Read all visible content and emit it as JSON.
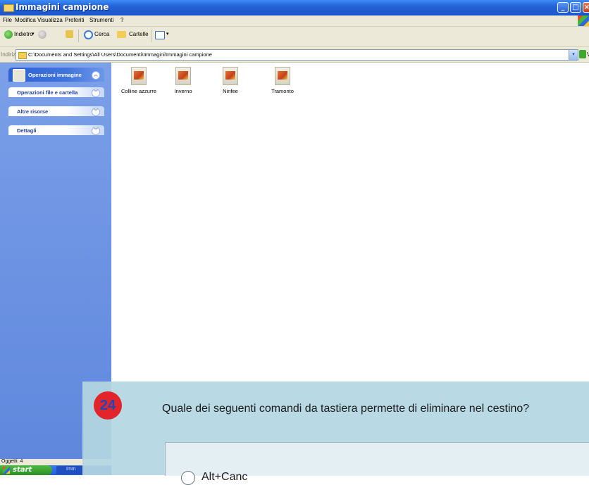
{
  "window": {
    "title": "Immagini campione"
  },
  "menu": [
    "File",
    "Modifica",
    "Visualizza",
    "Preferiti",
    "Strumenti",
    "?"
  ],
  "toolbar": {
    "back_label": "Indietro",
    "search_label": "Cerca",
    "folders_label": "Cartelle"
  },
  "address": {
    "label": "Indirizzo",
    "path": "C:\\Documents and Settings\\All Users\\Documenti\\Immagini\\Immagini campione",
    "go_label": "Va"
  },
  "taskpane": {
    "panels": [
      {
        "label": "Operazioni immagine"
      },
      {
        "label": "Operazioni file e cartella"
      },
      {
        "label": "Altre risorse"
      },
      {
        "label": "Dettagli"
      }
    ]
  },
  "files": [
    {
      "name": "Colline azzurre"
    },
    {
      "name": "Inverno"
    },
    {
      "name": "Ninfee"
    },
    {
      "name": "Tramonto"
    }
  ],
  "status": {
    "text": "Oggetti: 4"
  },
  "taskbar": {
    "start_label": "start",
    "task_label": "Imm"
  },
  "quiz": {
    "number": "24",
    "question": "Quale dei seguenti comandi da tastiera permette di eliminare nel cestino?",
    "answer": "Alt+Canc"
  }
}
